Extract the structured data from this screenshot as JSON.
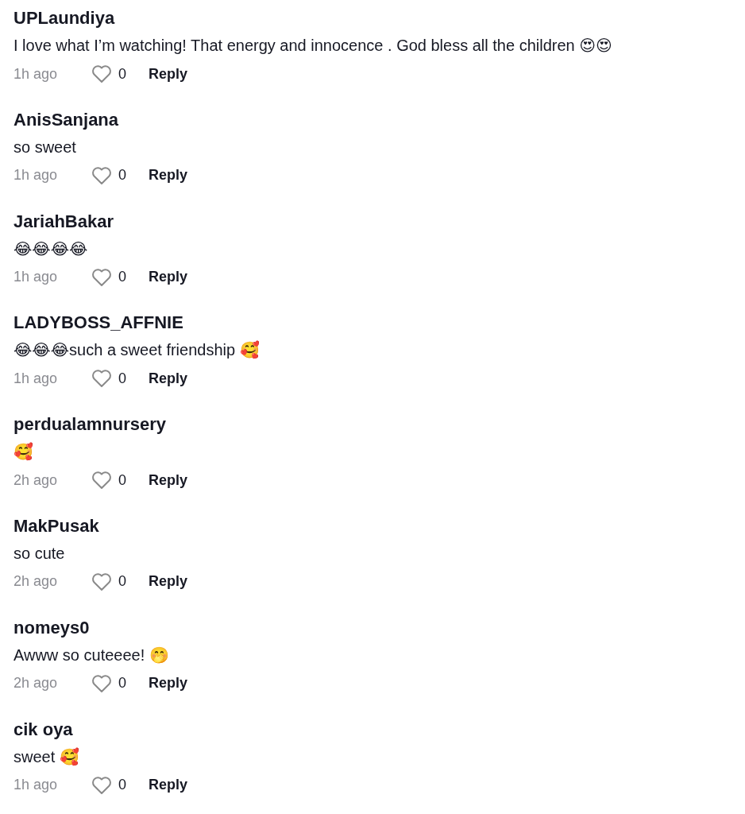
{
  "comments": [
    {
      "username": "UPLaundiya",
      "text": "I love what I’m watching! That energy and innocence . God bless all the children 😍😍",
      "time": "1h ago",
      "likes": "0",
      "reply": "Reply"
    },
    {
      "username": "AnisSanjana",
      "text": "so sweet",
      "time": "1h ago",
      "likes": "0",
      "reply": "Reply"
    },
    {
      "username": "JariahBakar",
      "text": "😂😂😂😂",
      "time": "1h ago",
      "likes": "0",
      "reply": "Reply"
    },
    {
      "username": "LADYBOSS_AFFNIE",
      "text": "😂😂😂such a sweet friendship 🥰",
      "time": "1h ago",
      "likes": "0",
      "reply": "Reply"
    },
    {
      "username": "perdualamnursery",
      "text": "🥰",
      "time": "2h ago",
      "likes": "0",
      "reply": "Reply"
    },
    {
      "username": "MakPusak",
      "text": "so cute",
      "time": "2h ago",
      "likes": "0",
      "reply": "Reply"
    },
    {
      "username": "nomeys0",
      "text": "Awww so cuteeee! 🤭",
      "time": "2h ago",
      "likes": "0",
      "reply": "Reply"
    },
    {
      "username": "cik oya",
      "text": "sweet 🥰",
      "time": "1h ago",
      "likes": "0",
      "reply": "Reply"
    }
  ]
}
